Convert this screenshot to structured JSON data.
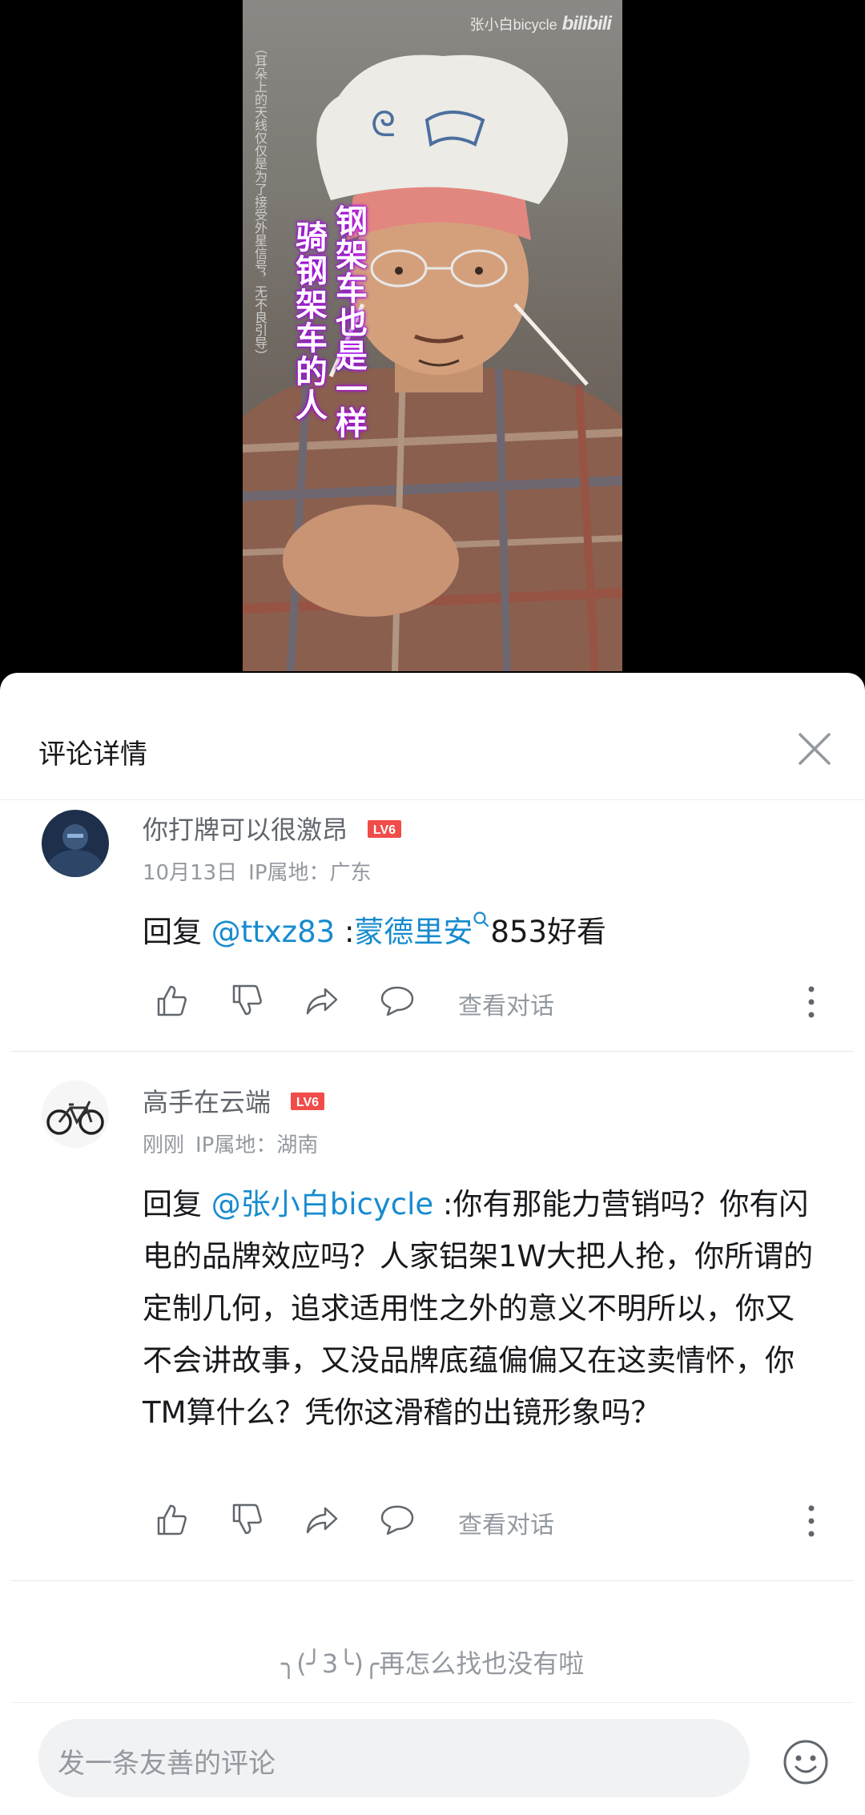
{
  "video": {
    "watermark_text": "张小白bicycle",
    "watermark_logo": "bilibili",
    "caption_line1": "钢架车也是一样",
    "caption_line2": "骑钢架车的人",
    "side_note": "（耳朵上的天线仅仅是为了接受外星信号，无不良引导）"
  },
  "sheet": {
    "title": "评论详情",
    "close_icon": "close-icon"
  },
  "comments": [
    {
      "username": "你打牌可以很激昂",
      "level": "LV6",
      "date": "10月13日",
      "ip": "IP属地：广东",
      "reply_prefix": "回复",
      "mention": "@ttxz83",
      "separator": " :",
      "keyword": "蒙德里安",
      "text_after": "853好看",
      "view_conversation": "查看对话"
    },
    {
      "username": "高手在云端",
      "level": "LV6",
      "date": "刚刚",
      "ip": "IP属地：湖南",
      "reply_prefix": "回复",
      "mention": "@张小白bicycle",
      "separator": " :",
      "text": "你有那能力营销吗？你有闪电的品牌效应吗？人家铝架1W大把人抢，你所谓的定制几何，追求适用性之外的意义不明所以，你又不会讲故事，又没品牌底蕴偏偏又在这卖情怀，你TM算什么？凭你这滑稽的出镜形象吗？",
      "view_conversation": "查看对话"
    }
  ],
  "end_message": "╮(╯3╰)╭再怎么找也没有啦",
  "input": {
    "placeholder": "发一条友善的评论"
  },
  "colors": {
    "link": "#178bcf",
    "level_badge": "#f04c49",
    "muted": "#9499a0"
  }
}
